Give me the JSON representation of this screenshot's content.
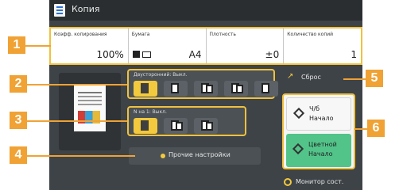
{
  "window": {
    "title": "Копия"
  },
  "info_row": {
    "zoom_label": "Коэфф. копирования",
    "zoom_value": "100%",
    "paper_label": "Бумага",
    "paper_value": "A4",
    "density_label": "Плотность",
    "density_value": "±0",
    "copies_label": "Количество копий",
    "copies_value": "1"
  },
  "duplex_group": {
    "label": "Двусторонний: Выкл."
  },
  "nup_group": {
    "label": "N на 1: Выкл."
  },
  "other_settings_label": "Прочие настройки",
  "reset_label": "Сброс",
  "start_bw": {
    "line1": "Ч/б",
    "line2": "Начало"
  },
  "start_color": {
    "line1": "Цветной",
    "line2": "Начало"
  },
  "status_monitor_label": "Монитор сост.",
  "callouts": [
    "1",
    "2",
    "3",
    "4",
    "5",
    "6"
  ],
  "colors": {
    "accent": "#f0c13e",
    "callout": "#f0a234",
    "start_color": "#52c48a",
    "screen": "#3e4347"
  }
}
